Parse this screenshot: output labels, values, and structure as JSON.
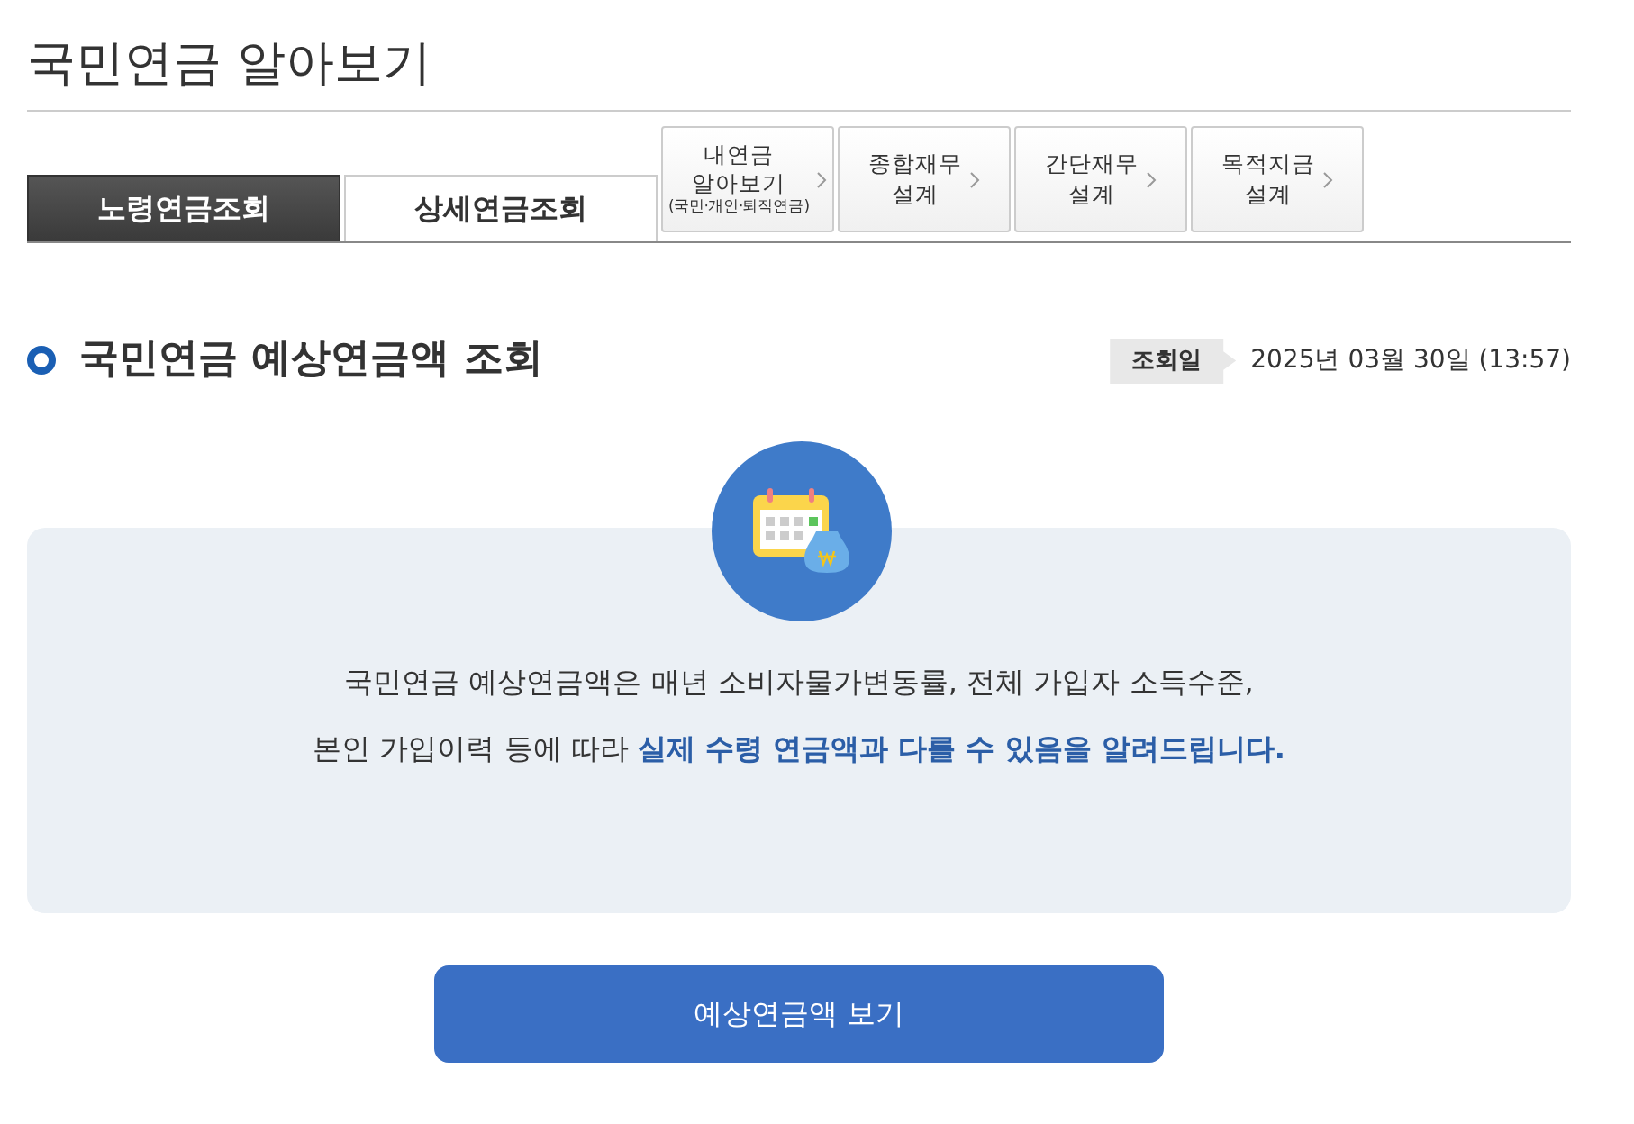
{
  "page_title": "국민연금 알아보기",
  "tabs": [
    {
      "kind": "main",
      "label": "노령연금조회",
      "selected": true
    },
    {
      "kind": "main",
      "label": "상세연금조회",
      "selected": false
    },
    {
      "kind": "link",
      "label": "내연금\n알아보기",
      "note": "(국민·개인·퇴직연금)"
    },
    {
      "kind": "link",
      "label": "종합재무\n설계"
    },
    {
      "kind": "link",
      "label": "간단재무\n설계"
    },
    {
      "kind": "link",
      "label": "목적지금\n설계"
    }
  ],
  "section": {
    "title": "국민연금 예상연금액 조회",
    "date_label": "조회일",
    "date": "2025년 03월 30일 (13:57)"
  },
  "notice": "국민연금 예상연금액은 매년 소비자물가변동률, 전체 가입자 소득수준,\n본인 가입이력 등에 따라 **실제 수령 연금액과 다를 수 있음을 알려드립니다.**",
  "button": "예상연금액 보기"
}
